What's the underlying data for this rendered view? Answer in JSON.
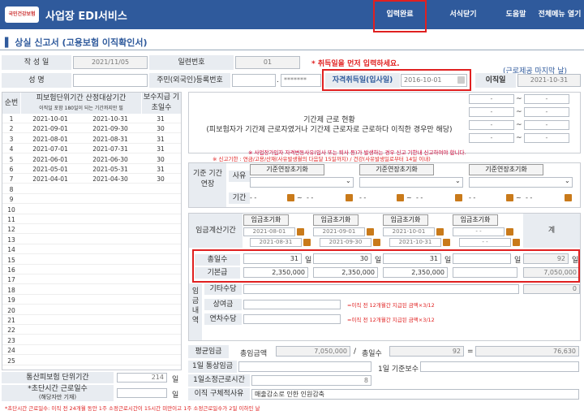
{
  "header": {
    "logo_text": "국민건강보험",
    "title": "사업장 EDI서비스",
    "complete_btn": "입력완료",
    "close_btn": "서식닫기",
    "help_btn": "도움말",
    "allmenu_btn": "전체메뉴 열기"
  },
  "page_title": "상실 신고서 (고용보험 이직확인서)",
  "form": {
    "written_date_label": "작 성 일",
    "written_date": "2021/11/05",
    "serial_label": "일련번호",
    "serial": "01",
    "warning": "* 취득일을 먼저 입력하세요.",
    "hint": "(근로제공 마지막 날)",
    "name_label": "성    명",
    "rrn_label": "주민(외국인)등록번호",
    "rrn_dot": ".",
    "rrn_mask": "*******",
    "acq_label": "자격취득일(입사일)",
    "acq_date": "2016-10-01",
    "leave_label": "이직일",
    "leave_date": "2021-10-31"
  },
  "left_table": {
    "h_no": "순번",
    "h_period": "피보험단위기간 산정대상기간",
    "h_period_sub": "이직일 포함 180일이 되는 기간까지만 필",
    "h_days": "보수지급 기초일수",
    "rows": [
      {
        "no": "1",
        "from": "2021-10-01",
        "to": "2021-10-31",
        "days": "31"
      },
      {
        "no": "2",
        "from": "2021-09-01",
        "to": "2021-09-30",
        "days": "30"
      },
      {
        "no": "3",
        "from": "2021-08-01",
        "to": "2021-08-31",
        "days": "31"
      },
      {
        "no": "4",
        "from": "2021-07-01",
        "to": "2021-07-31",
        "days": "31"
      },
      {
        "no": "5",
        "from": "2021-06-01",
        "to": "2021-06-30",
        "days": "30"
      },
      {
        "no": "6",
        "from": "2021-05-01",
        "to": "2021-05-31",
        "days": "31"
      },
      {
        "no": "7",
        "from": "2021-04-01",
        "to": "2021-04-30",
        "days": "30"
      },
      {
        "no": "8",
        "from": "",
        "to": "",
        "days": ""
      },
      {
        "no": "9",
        "from": "",
        "to": "",
        "days": ""
      },
      {
        "no": "10",
        "from": "",
        "to": "",
        "days": ""
      },
      {
        "no": "11",
        "from": "",
        "to": "",
        "days": ""
      },
      {
        "no": "12",
        "from": "",
        "to": "",
        "days": ""
      },
      {
        "no": "13",
        "from": "",
        "to": "",
        "days": ""
      },
      {
        "no": "14",
        "from": "",
        "to": "",
        "days": ""
      },
      {
        "no": "15",
        "from": "",
        "to": "",
        "days": ""
      },
      {
        "no": "16",
        "from": "",
        "to": "",
        "days": ""
      },
      {
        "no": "17",
        "from": "",
        "to": "",
        "days": ""
      },
      {
        "no": "18",
        "from": "",
        "to": "",
        "days": ""
      },
      {
        "no": "19",
        "from": "",
        "to": "",
        "days": ""
      },
      {
        "no": "20",
        "from": "",
        "to": "",
        "days": ""
      },
      {
        "no": "21",
        "from": "",
        "to": "",
        "days": ""
      },
      {
        "no": "22",
        "from": "",
        "to": "",
        "days": ""
      },
      {
        "no": "23",
        "from": "",
        "to": "",
        "days": ""
      },
      {
        "no": "24",
        "from": "",
        "to": "",
        "days": ""
      },
      {
        "no": "25",
        "from": "",
        "to": "",
        "days": ""
      }
    ],
    "total_label": "통산피보험 단위기간",
    "total_value": "214",
    "unit_day": "일",
    "short_label": "*초단시간 근로일수",
    "short_sub": "(해당자만 기재)"
  },
  "fixed_term": {
    "text1": "기간제 근로 현황",
    "text2": "(피보험자가 기간제 근로자였거나 기간제 근로자로 근로하다 이직한 경우만 해당)",
    "dash": "-",
    "tilde": "~"
  },
  "notices": {
    "n1": "※ 사업장가입자 자격변동사유(입사 또는 퇴사 등)가 발생하는 경우 신고 기한내 신고하여야 합니다.",
    "n2": "※ 신고기한 : 연금/고용/산재(사유발생월의 다음달 15일까지) / 건강(사유발생일로부터 14일 이내)"
  },
  "extension": {
    "label": "기준 기간 연장",
    "reason_label": "사유",
    "period_label": "기간",
    "reset_btn": "기준연장초기화",
    "dash": "- -",
    "tilde": "~"
  },
  "wage": {
    "calc_label": "임금계산기간",
    "reset_btn": "임금초기화",
    "periods": [
      {
        "from": "2021-08-01",
        "to": "2021-08-31"
      },
      {
        "from": "2021-09-01",
        "to": "2021-09-30"
      },
      {
        "from": "2021-10-01",
        "to": "2021-10-31"
      },
      {
        "from": "- -",
        "to": "- -"
      }
    ],
    "total_col": "계",
    "total_days_label": "총일수",
    "days": [
      "31",
      "30",
      "31",
      ""
    ],
    "days_total": "92",
    "unit_day": "일",
    "base_label": "기본급",
    "base": [
      "2,350,000",
      "2,350,000",
      "2,350,000",
      ""
    ],
    "base_total": "7,050,000",
    "breakdown_label": "임금 내역",
    "other_label": "기타수당",
    "other_total": "0",
    "bonus_label": "상여금",
    "bonus_note": "=이직 전 12개월간 지급된 금액×3/12",
    "annual_label": "연차수당",
    "annual_note": "=이직 전 12개월간 지급된 금액×3/12"
  },
  "bottom": {
    "avg_label": "평균임금",
    "total_wage_label": "총임금액",
    "total_wage": "7,050,000",
    "slash": "/",
    "total_days_label": "총일수",
    "total_days": "92",
    "eq": "=",
    "avg_value": "76,630",
    "daily_label": "1일 통상임금",
    "base_day_label": "1일 기준보수",
    "hours_label": "1일소정근로시간",
    "hours_value": "8",
    "reason_label": "이직 구체적사유",
    "reason_value": "매출감소로 인한 인원감축"
  },
  "footnote": "*초단시간 근로일수: 이직 전 24개월 동안 1주 소정근로시간이 15시간 미만이고 1주 소정근로일수가 2일 이하인 날"
}
